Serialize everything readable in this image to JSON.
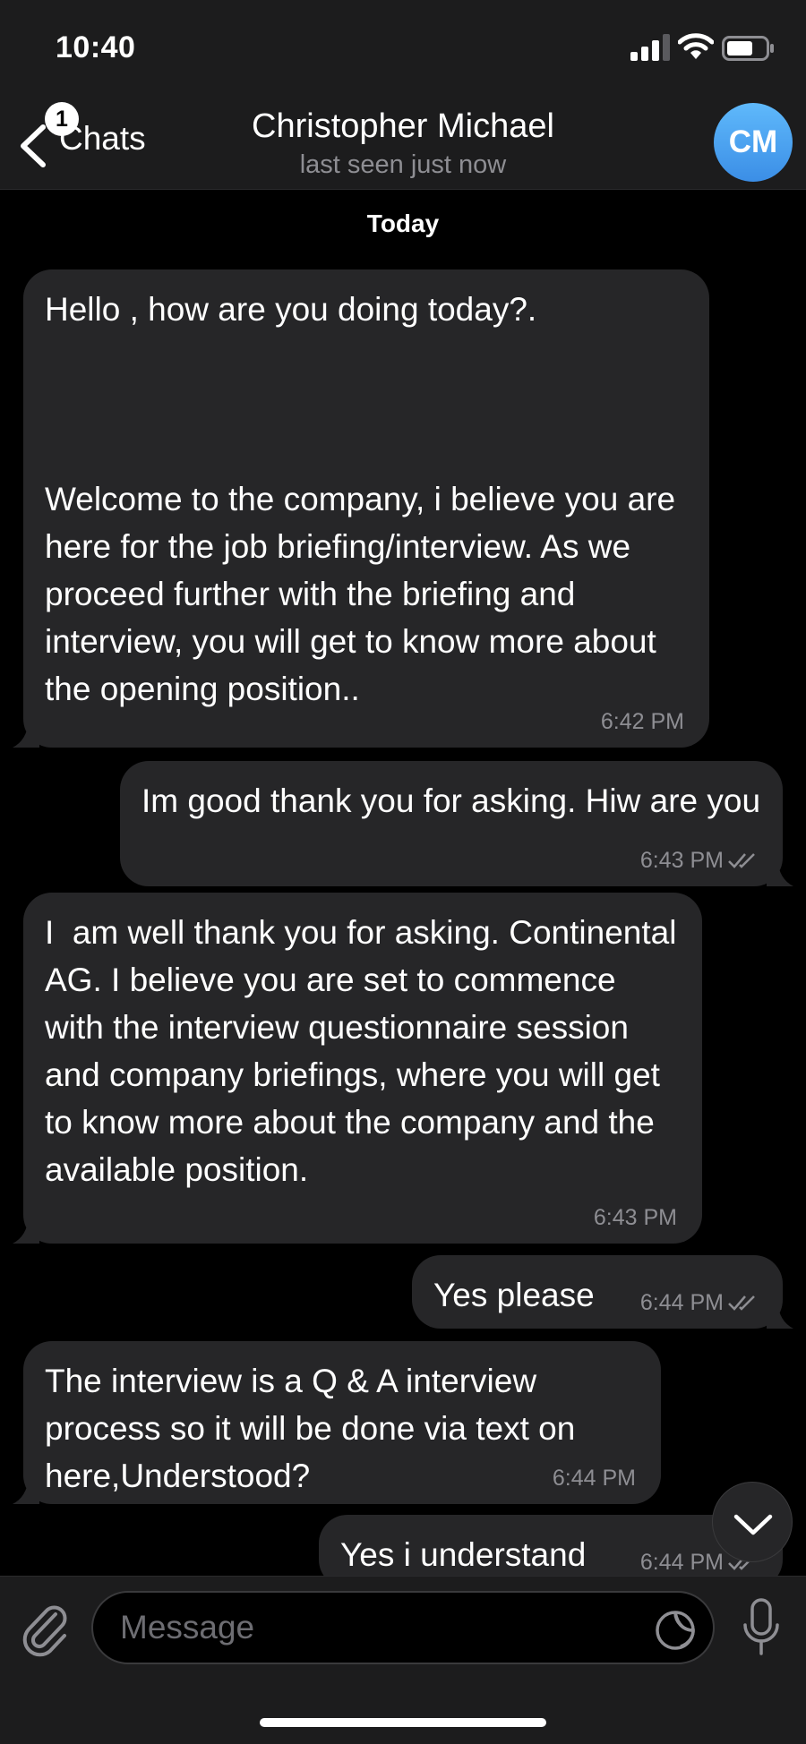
{
  "status_bar": {
    "time": "10:40"
  },
  "nav": {
    "back_label": "Chats",
    "unread_count": "1",
    "title": "Christopher Michael",
    "subtitle": "last seen just now",
    "avatar_initials": "CM"
  },
  "chat": {
    "date_separator": "Today",
    "messages": [
      {
        "direction": "incoming",
        "text": "Hello , how are you doing today?.\n\n\n\nWelcome to the company, i believe you are here for the job briefing/interview. As we proceed further with the briefing and interview, you will get to know more about the opening position..",
        "time": "6:42 PM"
      },
      {
        "direction": "outgoing",
        "text": "Im good thank you for asking. Hiw are you",
        "time": "6:43 PM",
        "status": "read"
      },
      {
        "direction": "incoming",
        "text": "I  am well thank you for asking. Continental AG. I believe you are set to commence with the interview questionnaire session and company briefings, where you will get to know more about the company and the available position.",
        "time": "6:43 PM"
      },
      {
        "direction": "outgoing",
        "text": "Yes please",
        "time": "6:44 PM",
        "status": "read"
      },
      {
        "direction": "incoming",
        "text": "The interview is a Q & A interview process so it will be done via text on here,Understood?",
        "time": "6:44 PM"
      },
      {
        "direction": "outgoing",
        "text": "Yes i understand",
        "time": "6:44 PM",
        "status": "read"
      }
    ]
  },
  "input": {
    "placeholder": "Message"
  },
  "icons": {
    "back": "chevron-left-icon",
    "attach": "paperclip-icon",
    "sticker": "sticker-icon",
    "mic": "microphone-icon",
    "scroll": "chevron-down-icon",
    "read": "double-check-icon"
  },
  "colors": {
    "background": "#000000",
    "header": "#1c1c1d",
    "bubble": "#262628",
    "meta_text": "#8e8e93",
    "avatar": "#4aa3f0"
  }
}
